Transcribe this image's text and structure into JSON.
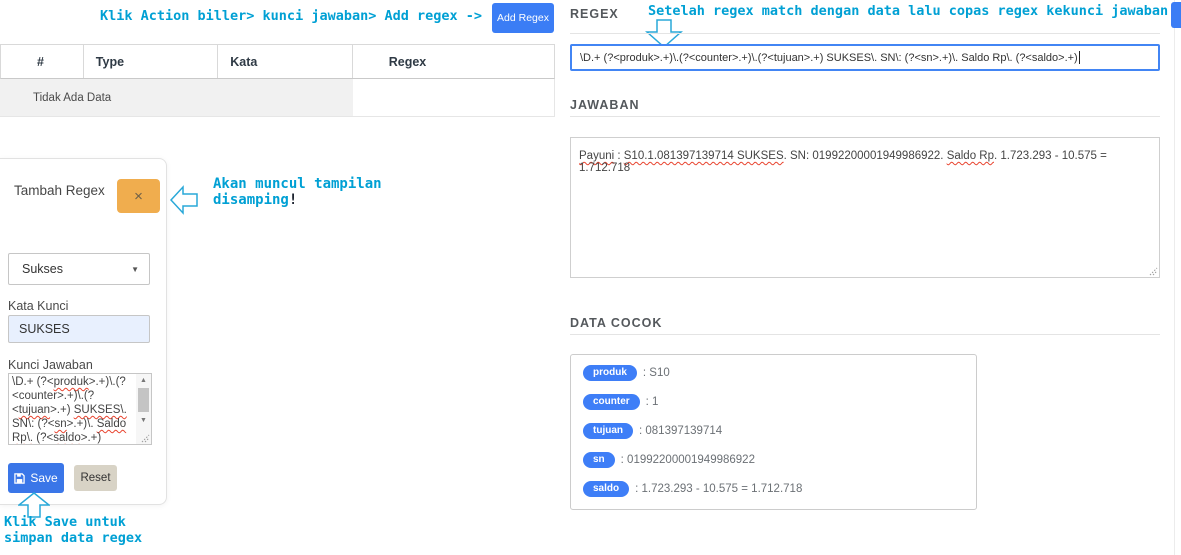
{
  "colors": {
    "annotation": "#00a0d4",
    "primary": "#3b7df5",
    "save": "#3a76e8",
    "badge": "#3e7ef7",
    "warning": "#f0ad4e",
    "wavy": "#e8432e"
  },
  "annotations": {
    "top_left": "Klik Action biller> kunci jawaban> Add regex ->",
    "top_right": "Setelah regex match dengan data lalu copas regex kekunci jawaban",
    "beside_modal_line1": "Akan muncul tampilan",
    "beside_modal_line2": "disamping",
    "beside_modal_bang": "!",
    "below_save_line1": "Klik Save untuk",
    "below_save_line2": "simpan data regex"
  },
  "toolbar": {
    "add_regex_label": "Add Regex"
  },
  "table": {
    "headers": [
      "#",
      "Type",
      "Kata",
      "Regex"
    ],
    "empty_text": "Tidak Ada Data"
  },
  "modal": {
    "title": "Tambah Regex",
    "close_label": "×",
    "type_select_value": "Sukses",
    "kata_kunci_label": "Kata Kunci",
    "kata_kunci_value": "SUKSES",
    "kunci_jawaban_label": "Kunci Jawaban",
    "kunci_jawaban_lines": [
      [
        {
          "t": "\\D.+ (?<"
        },
        {
          "t": "produk",
          "w": true
        },
        {
          "t": ">.+)\\.(?"
        }
      ],
      [
        {
          "t": "<counter>.+)\\.(?"
        }
      ],
      [
        {
          "t": "<"
        },
        {
          "t": "tujuan",
          "w": true
        },
        {
          "t": ">.+) "
        },
        {
          "t": "SUKSES\\.",
          "w": true
        }
      ],
      [
        {
          "t": "SN\\: (?<"
        },
        {
          "t": "sn",
          "w": true
        },
        {
          "t": ">.+)\\. "
        },
        {
          "t": "Saldo",
          "w": true
        }
      ],
      [
        {
          "t": "Rp\\.",
          "w": true
        },
        {
          "t": " (?<"
        },
        {
          "t": "saldo",
          "w": true
        },
        {
          "t": ">.+)"
        }
      ]
    ],
    "save_label": "Save",
    "reset_label": "Reset"
  },
  "regex_section": {
    "heading": "REGEX",
    "input_value": "\\D.+ (?<produk>.+)\\.(?<counter>.+)\\.(?<tujuan>.+) SUKSES\\. SN\\: (?<sn>.+)\\. Saldo Rp\\. (?<saldo>.+)"
  },
  "jawaban_section": {
    "heading": "JAWABAN",
    "segments": [
      {
        "t": "Payuni",
        "w": true
      },
      {
        "t": " : "
      },
      {
        "t": "S10.1.081397139714 SUKSES",
        "w": true
      },
      {
        "t": ". SN: 01992200001949986922. "
      },
      {
        "t": "Saldo Rp",
        "w": true
      },
      {
        "t": ". 1.723.293 - 10.575 = 1.712.718"
      }
    ]
  },
  "data_cocok_section": {
    "heading": "DATA COCOK",
    "separator": " : ",
    "items": [
      {
        "key": "produk",
        "value": "S10"
      },
      {
        "key": "counter",
        "value": "1"
      },
      {
        "key": "tujuan",
        "value": "081397139714"
      },
      {
        "key": "sn",
        "value": "01992200001949986922"
      },
      {
        "key": "saldo",
        "value": "1.723.293 - 10.575 = 1.712.718"
      }
    ]
  }
}
